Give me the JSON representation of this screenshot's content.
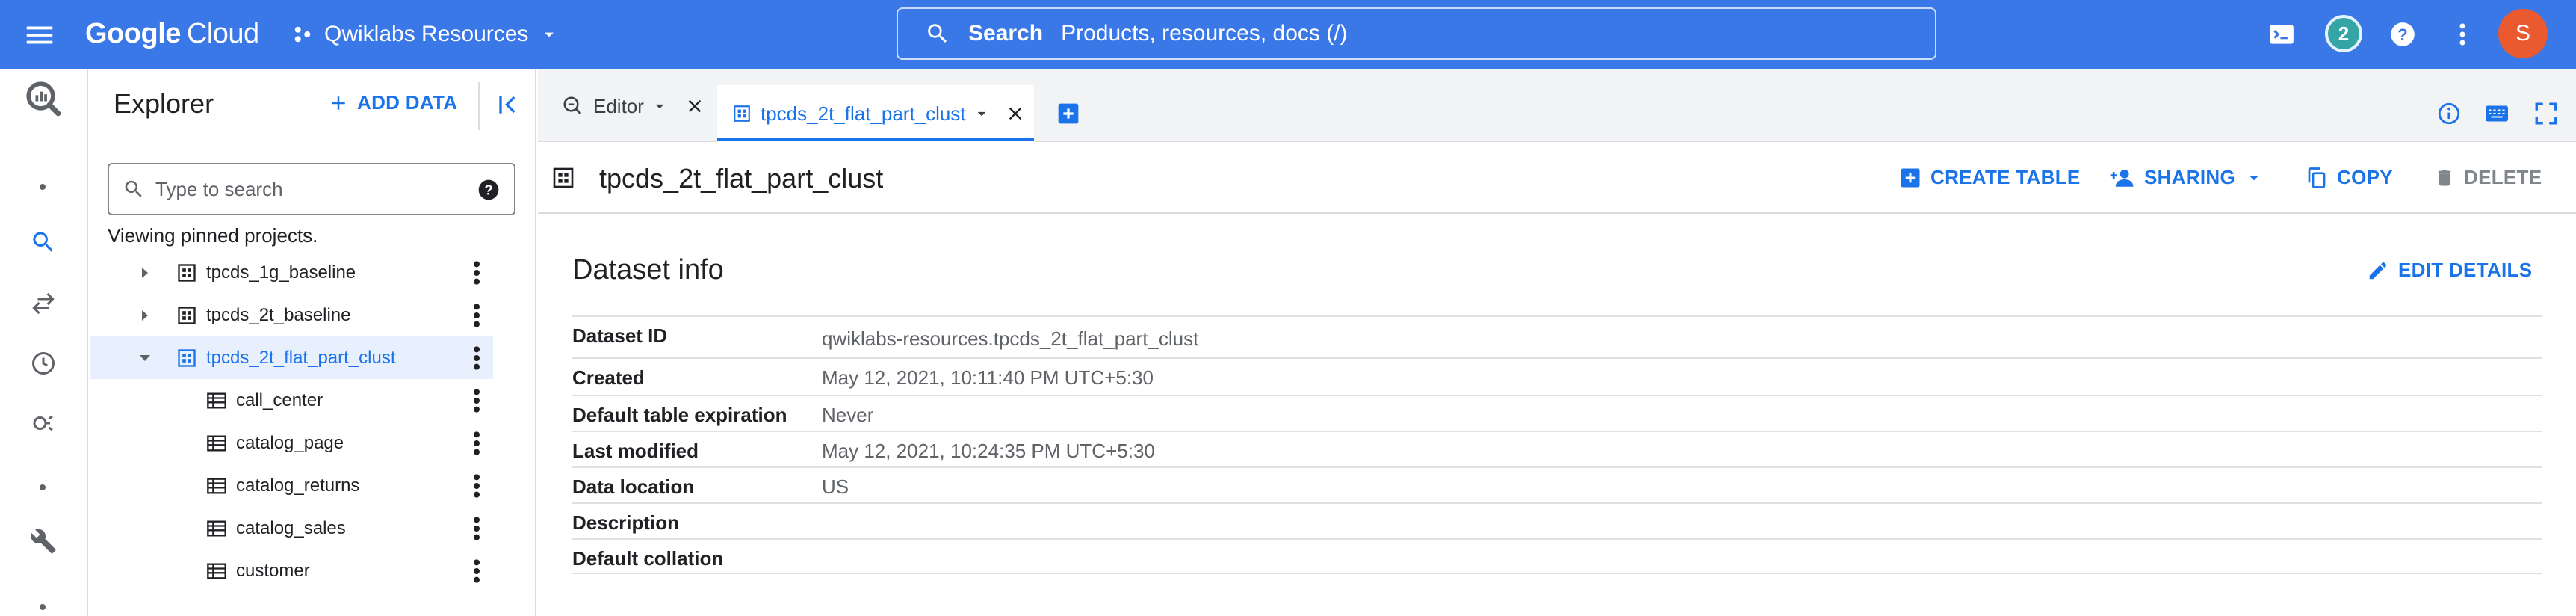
{
  "topbar": {
    "brand_bold": "Google",
    "brand_rest": "Cloud",
    "project_name": "Qwiklabs Resources",
    "search_label": "Search",
    "search_placeholder": "Products, resources, docs (/)",
    "notification_count": "2",
    "avatar_initial": "S",
    "colors": {
      "bar": "#3b78e7",
      "avatar": "#ea5a2e",
      "badge": "#34a4a4"
    }
  },
  "explorer": {
    "title": "Explorer",
    "add_data_label": "ADD DATA",
    "search_placeholder": "Type to search",
    "pinned_note": "Viewing pinned projects.",
    "tree": [
      {
        "label": "tpcds_1g_baseline",
        "type": "dataset",
        "expanded": false
      },
      {
        "label": "tpcds_2t_baseline",
        "type": "dataset",
        "expanded": false
      },
      {
        "label": "tpcds_2t_flat_part_clust",
        "type": "dataset",
        "expanded": true,
        "selected": true
      },
      {
        "label": "call_center",
        "type": "table"
      },
      {
        "label": "catalog_page",
        "type": "table"
      },
      {
        "label": "catalog_returns",
        "type": "table"
      },
      {
        "label": "catalog_sales",
        "type": "table"
      },
      {
        "label": "customer",
        "type": "table"
      }
    ]
  },
  "tabs": [
    {
      "label": "Editor",
      "icon": "query-icon",
      "active": false
    },
    {
      "label": "tpcds_2t_flat_part_clust",
      "icon": "dataset-icon",
      "active": true
    }
  ],
  "dataset": {
    "title": "tpcds_2t_flat_part_clust",
    "actions": {
      "create_table": "CREATE TABLE",
      "sharing": "SHARING",
      "copy": "COPY",
      "delete": "DELETE"
    },
    "info_title": "Dataset info",
    "edit_details": "EDIT DETAILS",
    "info_rows": [
      {
        "key": "Dataset ID",
        "value": "qwiklabs-resources.tpcds_2t_flat_part_clust"
      },
      {
        "key": "Created",
        "value": "May 12, 2021, 10:11:40 PM UTC+5:30"
      },
      {
        "key": "Default table expiration",
        "value": "Never"
      },
      {
        "key": "Last modified",
        "value": "May 12, 2021, 10:24:35 PM UTC+5:30"
      },
      {
        "key": "Data location",
        "value": "US"
      },
      {
        "key": "Description",
        "value": ""
      },
      {
        "key": "Default collation",
        "value": ""
      }
    ]
  }
}
